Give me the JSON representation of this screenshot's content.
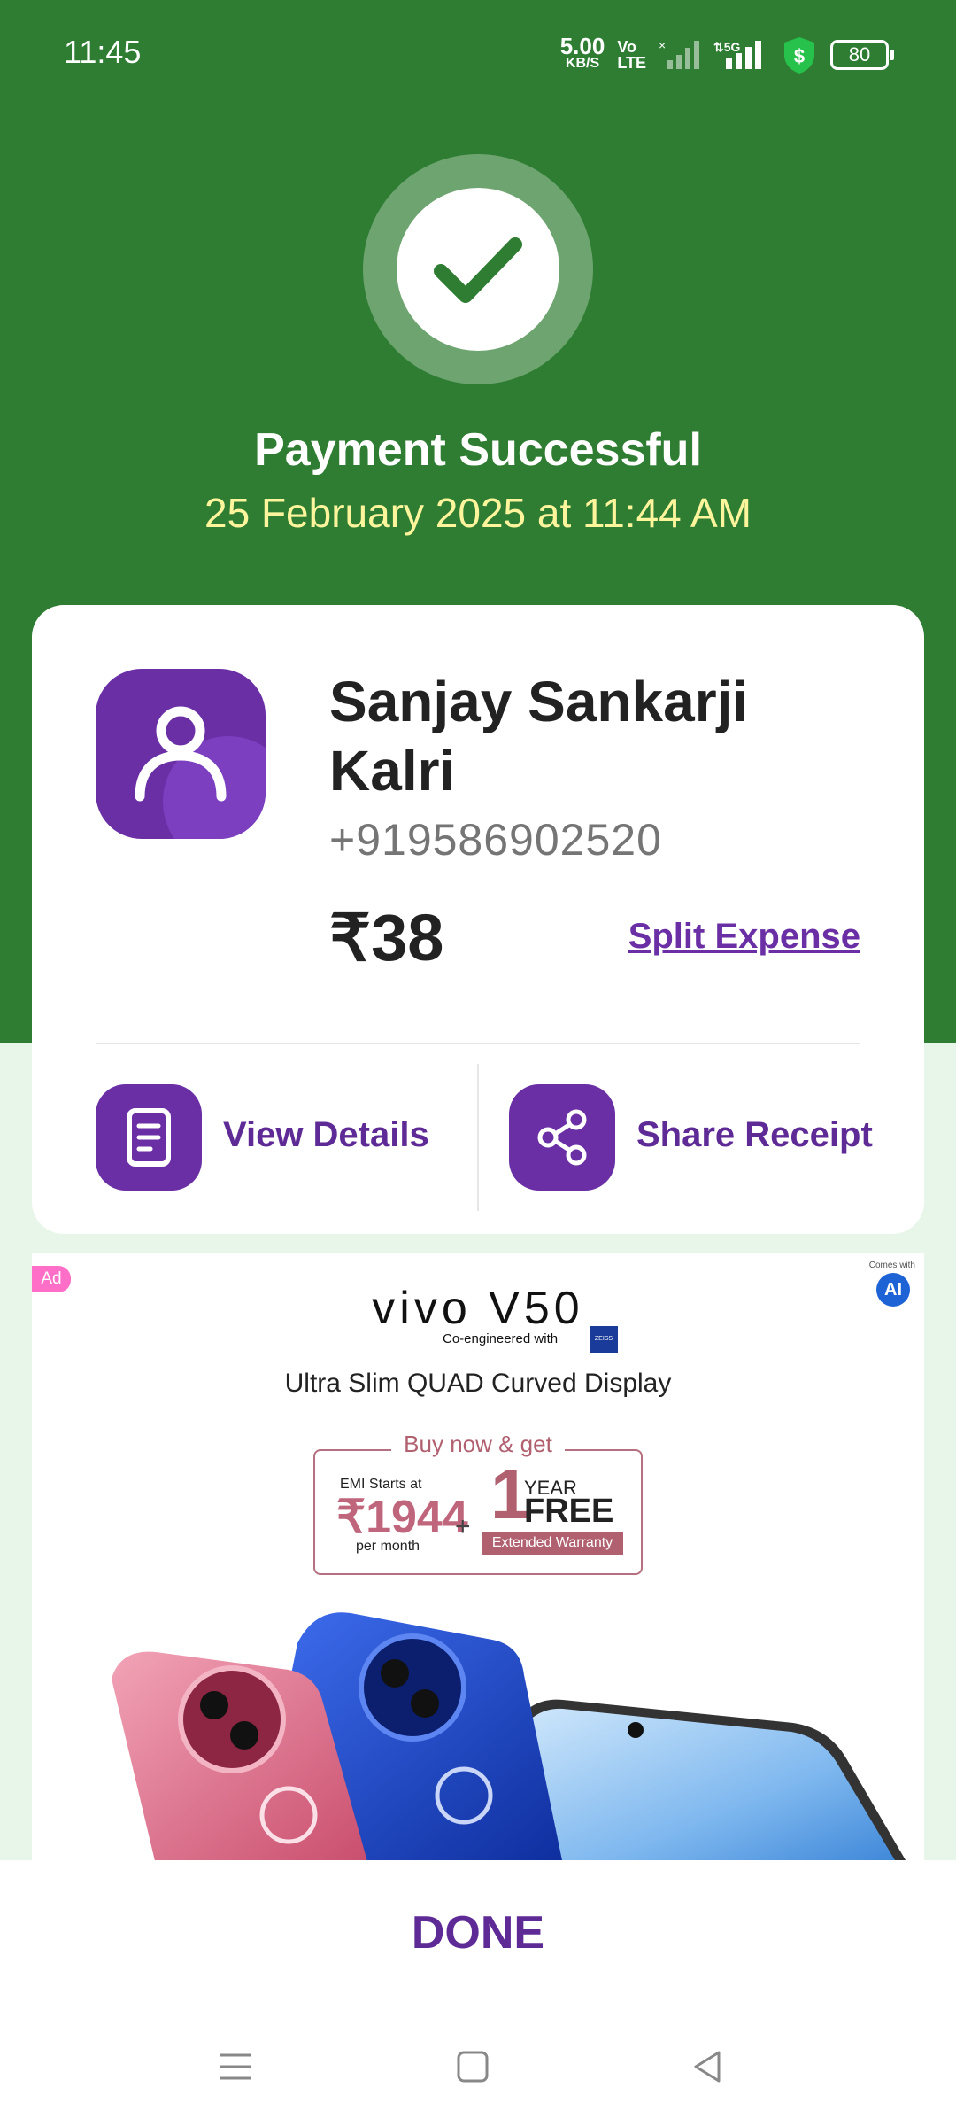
{
  "status_bar": {
    "time": "11:45",
    "net_speed": "5.00",
    "net_unit": "KB/S",
    "volte": "Vo\nLTE",
    "signal_5g": "5G",
    "battery": "80"
  },
  "header": {
    "title": "Payment Successful",
    "datetime": "25 February 2025 at 11:44 AM"
  },
  "payee": {
    "name": "Sanjay Sankarji Kalri",
    "phone": "+919586902520",
    "amount": "₹38",
    "split_label": "Split Expense"
  },
  "actions": {
    "view_details": "View Details",
    "share_receipt": "Share Receipt"
  },
  "ad": {
    "badge": "Ad",
    "ai_note": "Comes with",
    "ai_label": "AI",
    "brand": "vivo V50",
    "coengineered": "Co-engineered with",
    "zeiss": "ZEISS",
    "display": "Ultra Slim QUAD Curved Display",
    "offer_head": "Buy now & get",
    "emi_label": "EMI Starts at",
    "emi_value": "₹1944",
    "emi_per": "per month",
    "plus": "+",
    "year_num": "1",
    "year_label": "YEAR",
    "free_label": "FREE",
    "warranty": "Extended Warranty"
  },
  "footer": {
    "done_label": "DONE"
  },
  "colors": {
    "header_green": "#2e7d32",
    "accent_purple": "#6a2fa5",
    "date_yellow": "#fff59d",
    "pale_green": "#e8f5e9"
  }
}
